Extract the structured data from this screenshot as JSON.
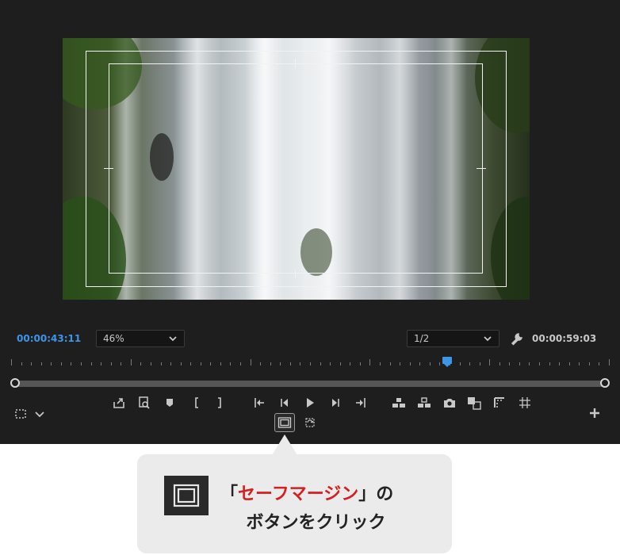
{
  "monitor": {
    "timecode_current": "00:00:43:11",
    "zoom_select": {
      "value": "46%"
    },
    "resolution_select": {
      "value": "1/2"
    },
    "timecode_duration": "00:00:59:03",
    "playhead_fraction": 0.73,
    "colors": {
      "accent": "#3d95ea",
      "panel": "#1e1e1e"
    },
    "controls_left": [
      "selection-zoom-icon",
      "chevron-down-icon"
    ],
    "controls_center": [
      "export-frame-icon",
      "insert-edit-icon",
      "add-marker-icon",
      "mark-in-icon",
      "mark-out-icon",
      "go-to-in-icon",
      "step-back-icon",
      "play-icon",
      "step-forward-icon",
      "go-to-out-icon",
      "lift-icon",
      "extract-icon",
      "camera-icon",
      "compare-view-icon",
      "film-strip-icon",
      "grid-icon"
    ],
    "controls_row2": [
      "safe-margins-icon",
      "toggle-proxies-icon"
    ],
    "button_editor_icon": "plus-icon"
  },
  "callout": {
    "open_bracket": "「",
    "highlight": "セーフマージン",
    "close_bracket": "」の",
    "line2": "ボタンをクリック",
    "colors": {
      "highlight": "#d42020",
      "bubble": "#ebebeb"
    },
    "icon": "safe-margins-icon"
  }
}
